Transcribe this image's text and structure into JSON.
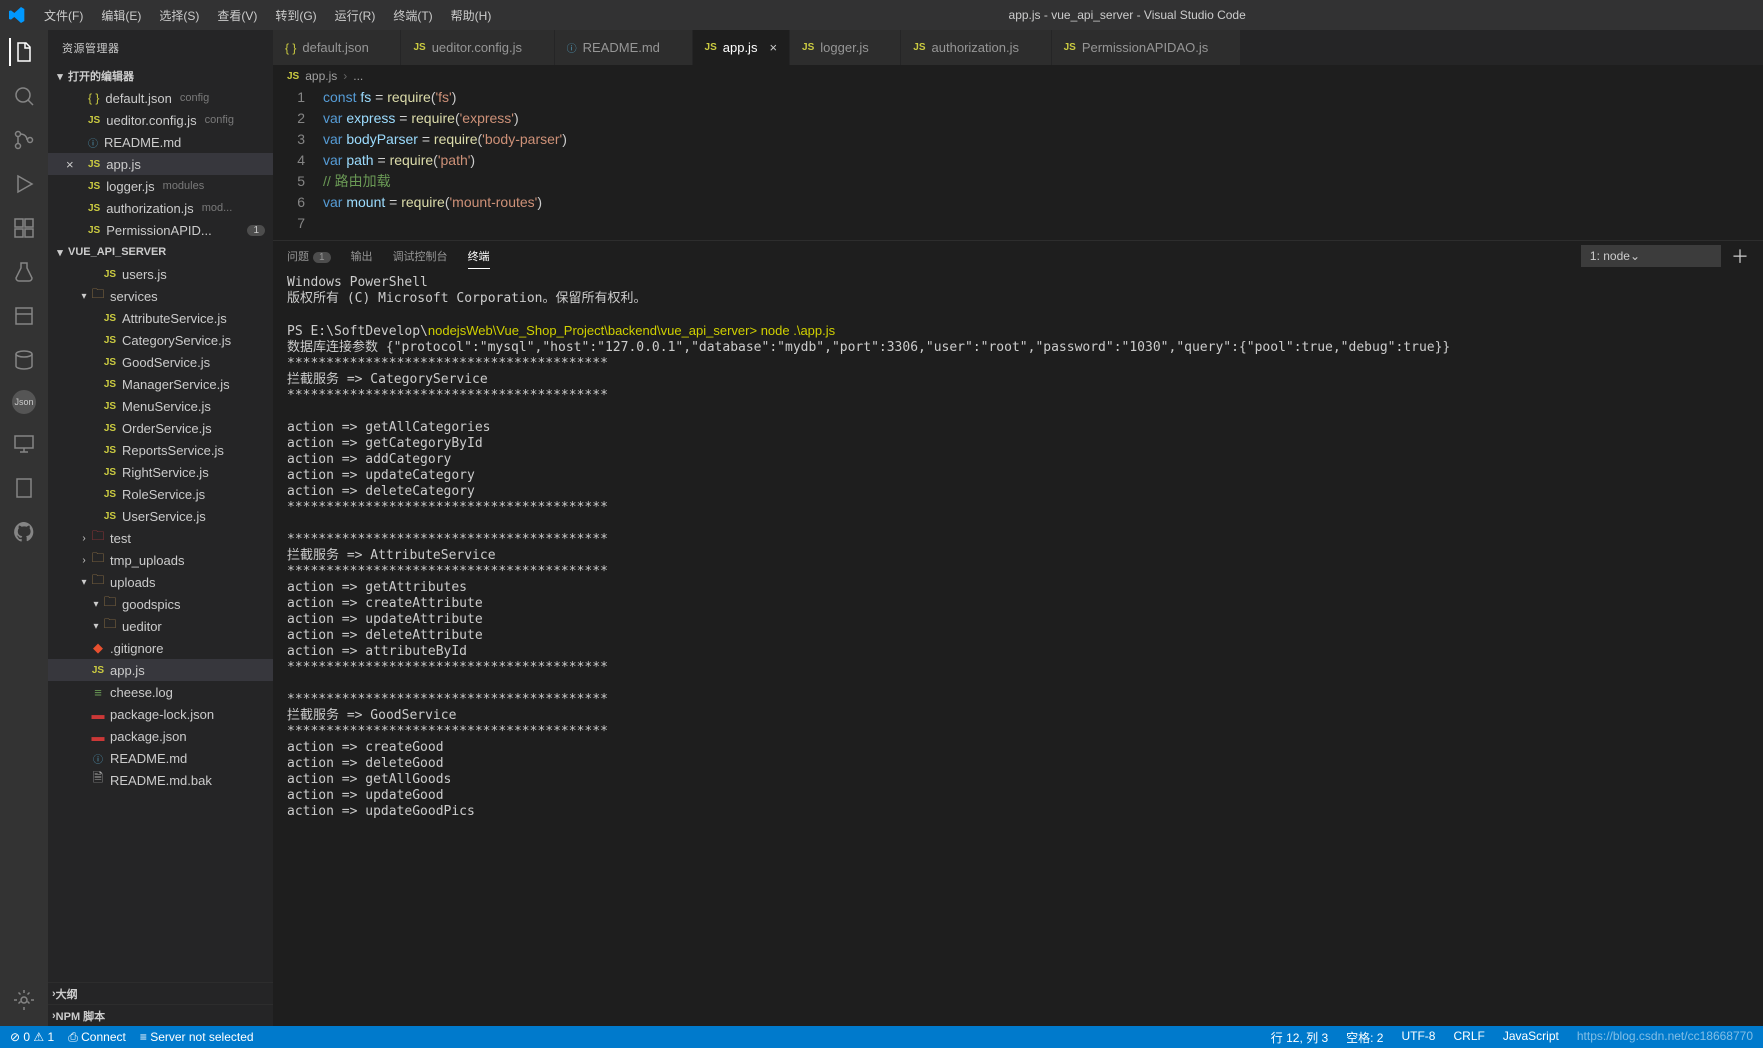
{
  "title": "app.js - vue_api_server - Visual Studio Code",
  "menu": [
    "文件(F)",
    "编辑(E)",
    "选择(S)",
    "查看(V)",
    "转到(G)",
    "运行(R)",
    "终端(T)",
    "帮助(H)"
  ],
  "sidebar_title": "资源管理器",
  "open_editors_label": "打开的编辑器",
  "open_editors": [
    {
      "icon": "json",
      "name": "default.json",
      "dim": "config"
    },
    {
      "icon": "js",
      "name": "ueditor.config.js",
      "dim": "config"
    },
    {
      "icon": "md",
      "name": "README.md",
      "dim": ""
    },
    {
      "icon": "js",
      "name": "app.js",
      "dim": "",
      "active": true
    },
    {
      "icon": "js",
      "name": "logger.js",
      "dim": "modules"
    },
    {
      "icon": "js",
      "name": "authorization.js",
      "dim": "mod..."
    },
    {
      "icon": "js",
      "name": "PermissionAPID...",
      "dim": "",
      "badge": "1"
    }
  ],
  "project_name": "VUE_API_SERVER",
  "tree": [
    {
      "indent": 3,
      "icon": "js",
      "name": "users.js"
    },
    {
      "indent": 2,
      "icon": "folder",
      "name": "services",
      "chev": "▾"
    },
    {
      "indent": 3,
      "icon": "js",
      "name": "AttributeService.js"
    },
    {
      "indent": 3,
      "icon": "js",
      "name": "CategoryService.js"
    },
    {
      "indent": 3,
      "icon": "js",
      "name": "GoodService.js"
    },
    {
      "indent": 3,
      "icon": "js",
      "name": "ManagerService.js"
    },
    {
      "indent": 3,
      "icon": "js",
      "name": "MenuService.js"
    },
    {
      "indent": 3,
      "icon": "js",
      "name": "OrderService.js"
    },
    {
      "indent": 3,
      "icon": "js",
      "name": "ReportsService.js"
    },
    {
      "indent": 3,
      "icon": "js",
      "name": "RightService.js"
    },
    {
      "indent": 3,
      "icon": "js",
      "name": "RoleService.js"
    },
    {
      "indent": 3,
      "icon": "js",
      "name": "UserService.js"
    },
    {
      "indent": 2,
      "icon": "folder-red",
      "name": "test",
      "chev": "›"
    },
    {
      "indent": 2,
      "icon": "folder",
      "name": "tmp_uploads",
      "chev": "›"
    },
    {
      "indent": 2,
      "icon": "folder",
      "name": "uploads",
      "chev": "▾"
    },
    {
      "indent": 3,
      "icon": "folder",
      "name": "goodspics",
      "chev": "▾"
    },
    {
      "indent": 3,
      "icon": "folder",
      "name": "ueditor",
      "chev": "▾"
    },
    {
      "indent": 2,
      "icon": "git",
      "name": ".gitignore"
    },
    {
      "indent": 2,
      "icon": "js",
      "name": "app.js",
      "active": true
    },
    {
      "indent": 2,
      "icon": "log",
      "name": "cheese.log"
    },
    {
      "indent": 2,
      "icon": "npm",
      "name": "package-lock.json"
    },
    {
      "indent": 2,
      "icon": "npm",
      "name": "package.json"
    },
    {
      "indent": 2,
      "icon": "md",
      "name": "README.md"
    },
    {
      "indent": 2,
      "icon": "gen",
      "name": "README.md.bak"
    }
  ],
  "outline_label": "大纲",
  "npm_label": "NPM 脚本",
  "tabs": [
    {
      "icon": "json",
      "name": "default.json"
    },
    {
      "icon": "js",
      "name": "ueditor.config.js"
    },
    {
      "icon": "md",
      "name": "README.md"
    },
    {
      "icon": "js",
      "name": "app.js",
      "active": true
    },
    {
      "icon": "js",
      "name": "logger.js"
    },
    {
      "icon": "js",
      "name": "authorization.js"
    },
    {
      "icon": "js",
      "name": "PermissionAPIDAO.js"
    }
  ],
  "breadcrumb": [
    "app.js",
    "..."
  ],
  "code_lines": [
    {
      "n": 1,
      "html": "<span class='tok-kw'>const</span> <span class='tok-var'>fs</span> <span class='tok-op'>=</span> <span class='tok-fn'>require</span>(<span class='tok-str'>'fs'</span>)"
    },
    {
      "n": 2,
      "html": "<span class='tok-kw'>var</span> <span class='tok-var'>express</span> <span class='tok-op'>=</span> <span class='tok-fn'>require</span>(<span class='tok-str'>'express'</span>)"
    },
    {
      "n": 3,
      "html": "<span class='tok-kw'>var</span> <span class='tok-var'>bodyParser</span> <span class='tok-op'>=</span> <span class='tok-fn'>require</span>(<span class='tok-str'>'body-parser'</span>)"
    },
    {
      "n": 4,
      "html": "<span class='tok-kw'>var</span> <span class='tok-var'>path</span> <span class='tok-op'>=</span> <span class='tok-fn'>require</span>(<span class='tok-str'>'path'</span>)"
    },
    {
      "n": 5,
      "html": "<span class='tok-com'>// 路由加载</span>"
    },
    {
      "n": 6,
      "html": "<span class='tok-kw'>var</span> <span class='tok-var'>mount</span> <span class='tok-op'>=</span> <span class='tok-fn'>require</span>(<span class='tok-str'>'mount-routes'</span>)"
    },
    {
      "n": 7,
      "html": ""
    }
  ],
  "panel_tabs": {
    "problems": "问题",
    "problems_badge": "1",
    "output": "输出",
    "debug": "调试控制台",
    "terminal": "终端"
  },
  "term_select": "1: node",
  "terminal": "Windows PowerShell\n版权所有 (C) Microsoft Corporation。保留所有权利。\n\nPS E:\\SoftDevelop\\nodejsWeb\\Vue_Shop_Project\\backend\\vue_api_server> node .\\app.js\n数据库连接参数 {\"protocol\":\"mysql\",\"host\":\"127.0.0.1\",\"database\":\"mydb\",\"port\":3306,\"user\":\"root\",\"password\":\"1030\",\"query\":{\"pool\":true,\"debug\":true}}\n*****************************************\n拦截服务 => CategoryService\n*****************************************\n\naction => getAllCategories\naction => getCategoryById\naction => addCategory\naction => updateCategory\naction => deleteCategory\n*****************************************\n\n*****************************************\n拦截服务 => AttributeService\n*****************************************\naction => getAttributes\naction => createAttribute\naction => updateAttribute\naction => deleteAttribute\naction => attributeById\n*****************************************\n\n*****************************************\n拦截服务 => GoodService\n*****************************************\naction => createGood\naction => deleteGood\naction => getAllGoods\naction => updateGood\naction => updateGoodPics",
  "status": {
    "err": "0",
    "warn": "1",
    "connect": "Connect",
    "server": "Server not selected",
    "ln": "行 12, 列 3",
    "spaces": "空格: 2",
    "enc": "UTF-8",
    "eol": "CRLF",
    "lang": "JavaScript",
    "watermark": "https://blog.csdn.net/cc18668770"
  }
}
